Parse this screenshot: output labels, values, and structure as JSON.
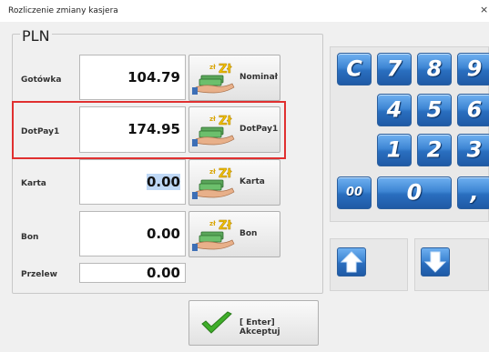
{
  "window": {
    "title": "Rozliczenie zmiany kasjera",
    "close_glyph": "×"
  },
  "currency": "PLN",
  "rows": [
    {
      "label": "Gotówka",
      "amount": "104.79",
      "button_label": "Nominał",
      "button_icon": "cash-hand-icon"
    },
    {
      "label": "DotPay1",
      "amount": "174.95",
      "button_label": "DotPay1",
      "button_icon": "cash-hand-icon",
      "highlighted": true
    },
    {
      "label": "Karta",
      "amount": "0.00",
      "button_label": "Karta",
      "button_icon": "cash-hand-icon",
      "amount_selected": true
    },
    {
      "label": "Bon",
      "amount": "0.00",
      "button_label": "Bon",
      "button_icon": "cash-hand-icon"
    },
    {
      "label": "Przelew",
      "amount": "0.00"
    }
  ],
  "icon_text": {
    "coin_small": "zł",
    "coin_big": "Zł"
  },
  "keypad": {
    "clear": "C",
    "digits_row1": [
      "7",
      "8",
      "9"
    ],
    "digits_row2": [
      "4",
      "5",
      "6"
    ],
    "digits_row3": [
      "1",
      "2",
      "3"
    ],
    "double_zero": "00",
    "zero": "0",
    "comma": ","
  },
  "arrows": {
    "up_icon": "arrow-up-icon",
    "down_icon": "arrow-down-icon"
  },
  "accept": {
    "label": "[ Enter] Akceptuj",
    "icon": "checkmark-icon"
  },
  "colors": {
    "highlight": "#e03030",
    "key_blue": "#3e86d4",
    "check_green": "#3fae2a",
    "selection": "#bfd8f6"
  }
}
